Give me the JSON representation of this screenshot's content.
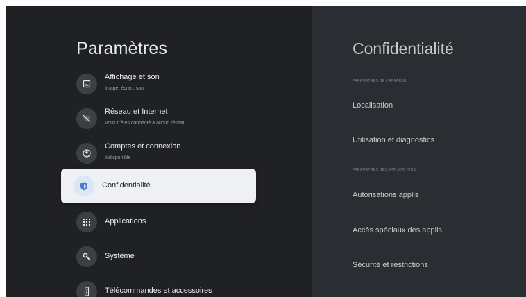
{
  "colors": {
    "background": "#202124",
    "right_panel": "#2a2d32",
    "selected_bg": "#eef0f3",
    "accent": "#4a7bd0"
  },
  "left": {
    "title": "Paramètres",
    "items": [
      {
        "label": "Affichage et son",
        "sub": "Image, écran, son",
        "icon": "display-icon"
      },
      {
        "label": "Réseau et Internet",
        "sub": "Vous n'êtes connecté à aucun réseau",
        "icon": "wifi-off-icon"
      },
      {
        "label": "Comptes et connexion",
        "sub": "Indisponible",
        "icon": "account-icon"
      },
      {
        "label": "Confidentialité",
        "sub": "",
        "icon": "shield-icon",
        "selected": true
      },
      {
        "label": "Applications",
        "sub": "",
        "icon": "apps-grid-icon"
      },
      {
        "label": "Système",
        "sub": "",
        "icon": "wrench-icon"
      },
      {
        "label": "Télécommandes et accessoires",
        "sub": "",
        "icon": "remote-icon"
      }
    ]
  },
  "right": {
    "title": "Confidentialité",
    "device_header": "PARAMÈTRES DE L'APPAREIL",
    "device_items": [
      "Localisation",
      "Utilisation et diagnostics"
    ],
    "apps_header": "PARAMÈTRES DES APPLICATIONS",
    "apps_items": [
      "Autorisations applis",
      "Accès spéciaux des applis",
      "Sécurité et restrictions"
    ]
  }
}
